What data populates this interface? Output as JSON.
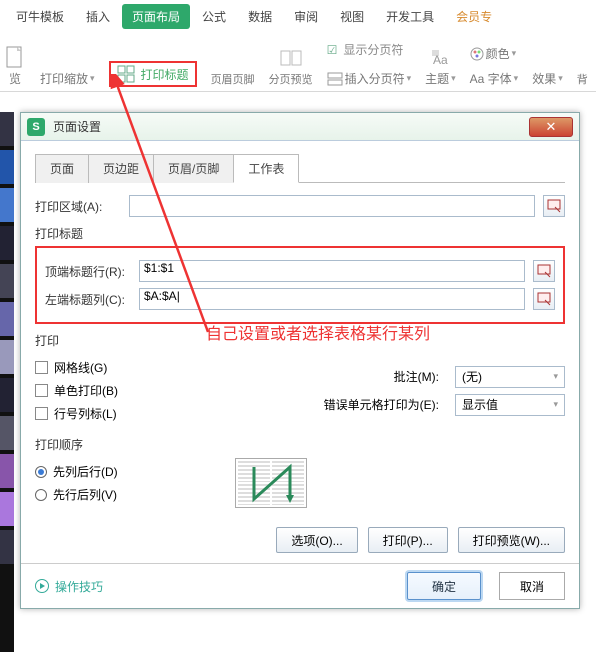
{
  "ribbon": {
    "tabs": [
      "可牛模板",
      "插入",
      "页面布局",
      "公式",
      "数据",
      "审阅",
      "视图",
      "开发工具",
      "会员专"
    ],
    "active": 2,
    "ctrls": {
      "view": "览",
      "scale": "打印缩放",
      "print_titles": "打印标题",
      "hf": "页眉页脚",
      "page_preview": "分页预览",
      "show_pb": "显示分页符",
      "insert_pb": "插入分页符",
      "theme": "主题",
      "color": "颜色",
      "font": "Aa 字体",
      "effect": "效果",
      "bg": "背"
    }
  },
  "dialog": {
    "title": "页面设置",
    "tabs": [
      "页面",
      "页边距",
      "页眉/页脚",
      "工作表"
    ],
    "active": 3,
    "print_area_lbl": "打印区域(A):",
    "print_area_val": "",
    "titles_section": "打印标题",
    "top_row_lbl": "顶端标题行(R):",
    "top_row_val": "$1:$1",
    "left_col_lbl": "左端标题列(C):",
    "left_col_val": "$A:$A",
    "left_col_val_disp": "$A:$A|",
    "print_section": "打印",
    "grid": "网格线(G)",
    "mono": "单色打印(B)",
    "rowcol": "行号列标(L)",
    "note_lbl": "批注(M):",
    "note_val": "(无)",
    "err_lbl": "错误单元格打印为(E):",
    "err_val": "显示值",
    "order_section": "打印顺序",
    "col_row": "先列后行(D)",
    "row_col": "先行后列(V)",
    "options": "选项(O)...",
    "print": "打印(P)...",
    "preview": "打印预览(W)...",
    "tips": "操作技巧",
    "ok": "确定",
    "cancel": "取消"
  },
  "annotation": "自己设置或者选择表格某行某列"
}
